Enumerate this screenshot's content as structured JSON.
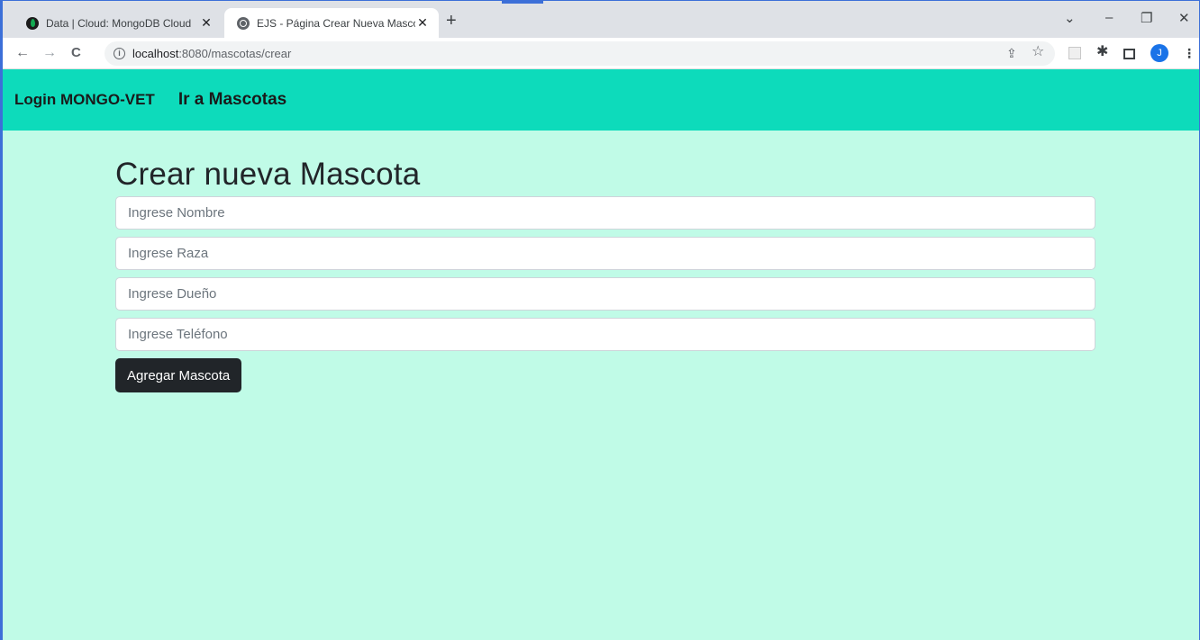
{
  "browser": {
    "tabs": [
      {
        "title": "Data | Cloud: MongoDB Cloud",
        "close": "✕"
      },
      {
        "title": "EJS - Página Crear Nueva Mascot",
        "close": "✕"
      }
    ],
    "new_tab": "+",
    "window_controls": {
      "dropdown": "⌄",
      "minimize": "–",
      "restore": "❐",
      "close": "✕"
    },
    "nav": {
      "back": "←",
      "forward": "→",
      "reload": "C"
    },
    "url_host": "localhost",
    "url_path": ":8080/mascotas/crear",
    "profile_initial": "J",
    "icons": {
      "share": "⇪",
      "star": "☆",
      "extensions": "✱",
      "menu": "⋮"
    }
  },
  "navbar": {
    "brand": "Login MONGO-VET",
    "link": "Ir a Mascotas",
    "bg_color": "#0ddbbb"
  },
  "page_bg_color": "#c0fbe7",
  "form": {
    "title": "Crear nueva Mascota",
    "fields": [
      {
        "placeholder": "Ingrese Nombre",
        "value": ""
      },
      {
        "placeholder": "Ingrese Raza",
        "value": ""
      },
      {
        "placeholder": "Ingrese Dueño",
        "value": ""
      },
      {
        "placeholder": "Ingrese Teléfono",
        "value": ""
      }
    ],
    "submit_label": "Agregar Mascota"
  }
}
